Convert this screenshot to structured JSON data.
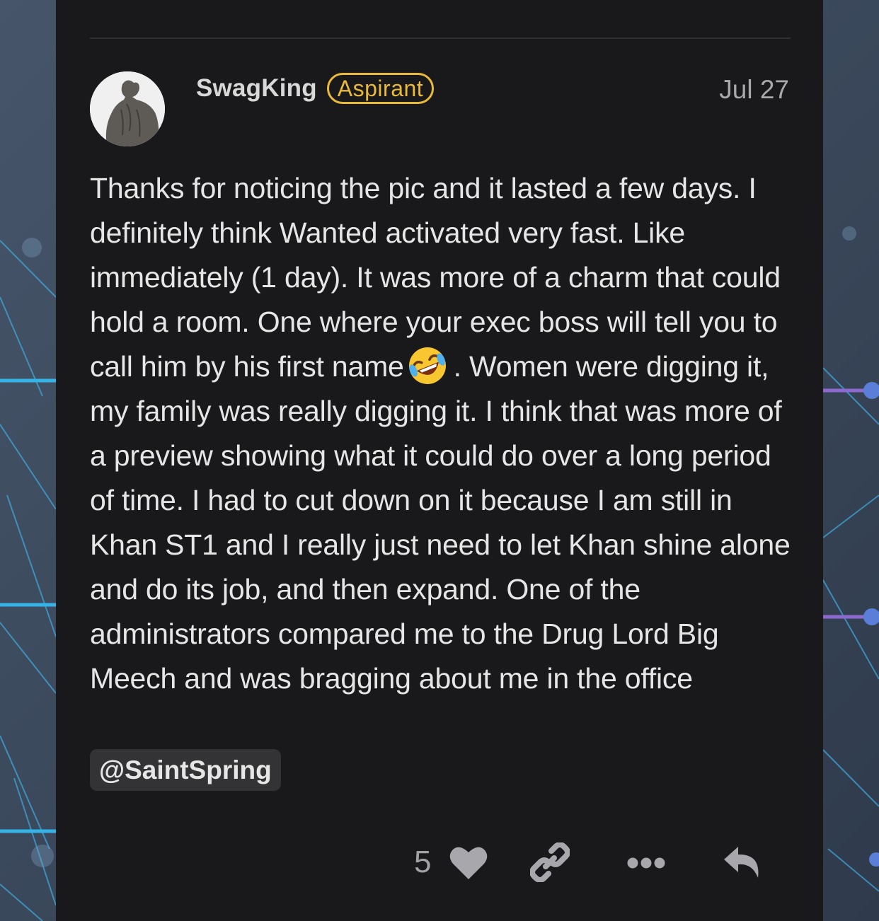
{
  "post": {
    "author": "SwagKing",
    "badge": "Aspirant",
    "date": "Jul 27",
    "body_part1": "Thanks for noticing the pic and it lasted a few days. I definitely think Wanted activated very fast. Like immediately (1 day). It was more of a charm that could hold a room. One where your exec boss will tell you to call him by his first name",
    "emoji": "rolling-on-floor-laughing-emoji",
    "body_part2": ". Women were digging it, my family was really digging it. I think that was more of a preview showing what it could do over a long period of time. I had to cut down on it because I am still in Khan ST1 and I really just need to let Khan shine alone and do its job, and then expand. One of the administrators compared me to the Drug Lord Big Meech and was bragging about me in the office",
    "mention": "@SaintSpring",
    "likes": "5"
  },
  "icons": {
    "like": "heart-icon",
    "share": "link-icon",
    "more": "ellipsis-icon",
    "reply": "reply-icon"
  },
  "colors": {
    "card_background": "#19191c",
    "badge": "#e9b93a",
    "page_background": "#3c4a5c"
  }
}
